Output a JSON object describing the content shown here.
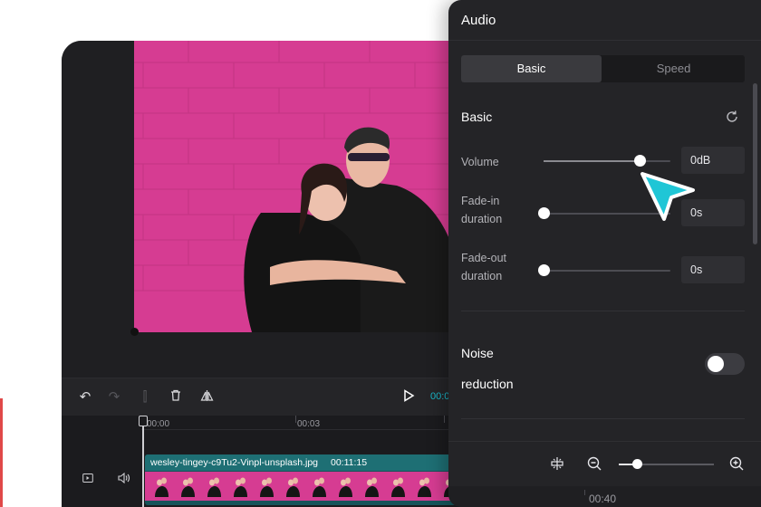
{
  "toolbar": {
    "undo_icon": "undo-icon",
    "redo_icon": "redo-icon",
    "split_icon": "split-icon",
    "delete_icon": "trash-icon",
    "mirror_icon": "mirror-icon",
    "play_icon": "play-icon",
    "current_time": "00:0"
  },
  "timeline": {
    "ticks": [
      "00:00",
      "00:03"
    ],
    "clip": {
      "filename": "wesley-tingey-c9Tu2-Vinpl-unsplash.jpg",
      "duration": "00:11:15"
    }
  },
  "panel": {
    "title": "Audio",
    "tabs": [
      {
        "label": "Basic",
        "active": true
      },
      {
        "label": "Speed",
        "active": false
      }
    ],
    "section_title": "Basic",
    "volume": {
      "label": "Volume",
      "value": "0dB",
      "level": 0.76
    },
    "fade_in": {
      "label": "Fade-in\nduration",
      "label_line1": "Fade-in",
      "label_line2": "duration",
      "value": "0s",
      "level": 0
    },
    "fade_out": {
      "label": "Fade-out\nduration",
      "label_line1": "Fade-out",
      "label_line2": "duration",
      "value": "0s",
      "level": 0
    },
    "noise": {
      "label_line1": "Noise",
      "label_line2": "reduction",
      "enabled": false
    },
    "bottom_time": "00:40"
  },
  "colors": {
    "accent": "#19b7c9",
    "panel_bg": "#242427",
    "editor_bg": "#1f1f22",
    "photo_bg": "#d63c92"
  }
}
